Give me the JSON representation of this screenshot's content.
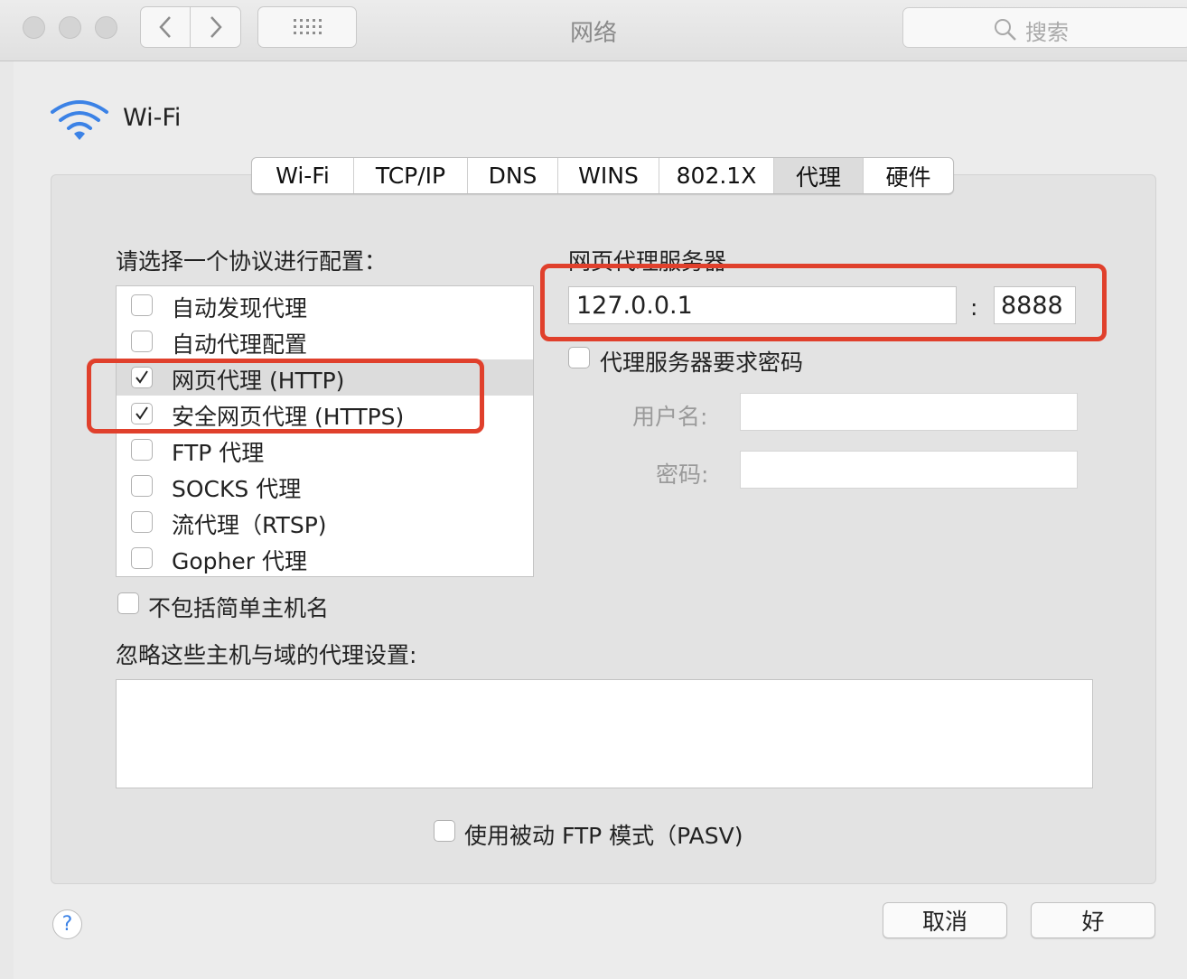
{
  "window": {
    "title": "网络",
    "search_placeholder": "搜索"
  },
  "service": {
    "name": "Wi-Fi"
  },
  "tabs": [
    {
      "label": "Wi-Fi"
    },
    {
      "label": "TCP/IP"
    },
    {
      "label": "DNS"
    },
    {
      "label": "WINS"
    },
    {
      "label": "802.1X"
    },
    {
      "label": "代理",
      "active": true
    },
    {
      "label": "硬件"
    }
  ],
  "protocols": {
    "heading": "请选择一个协议进行配置：",
    "items": [
      {
        "label": "自动发现代理",
        "checked": false
      },
      {
        "label": "自动代理配置",
        "checked": false
      },
      {
        "label": "网页代理 (HTTP)",
        "checked": true,
        "selected": true
      },
      {
        "label": "安全网页代理 (HTTPS)",
        "checked": true
      },
      {
        "label": "FTP 代理",
        "checked": false
      },
      {
        "label": "SOCKS 代理",
        "checked": false
      },
      {
        "label": "流代理（RTSP)",
        "checked": false
      },
      {
        "label": "Gopher 代理",
        "checked": false
      }
    ]
  },
  "proxy_server": {
    "heading": "网页代理服务器",
    "host": "127.0.0.1",
    "separator": ":",
    "port": "8888",
    "requires_password_label": "代理服务器要求密码",
    "requires_password": false,
    "username_label": "用户名:",
    "username": "",
    "password_label": "密码:",
    "password": ""
  },
  "exclude_simple_hostnames": {
    "label": "不包括简单主机名",
    "checked": false
  },
  "bypass": {
    "label": "忽略这些主机与域的代理设置:",
    "value": ""
  },
  "pasv": {
    "label": "使用被动 FTP 模式（PASV)",
    "checked": false
  },
  "buttons": {
    "cancel": "取消",
    "ok": "好",
    "help": "?"
  },
  "colors": {
    "highlight": "#e0402c",
    "accent": "#3b82e6"
  }
}
